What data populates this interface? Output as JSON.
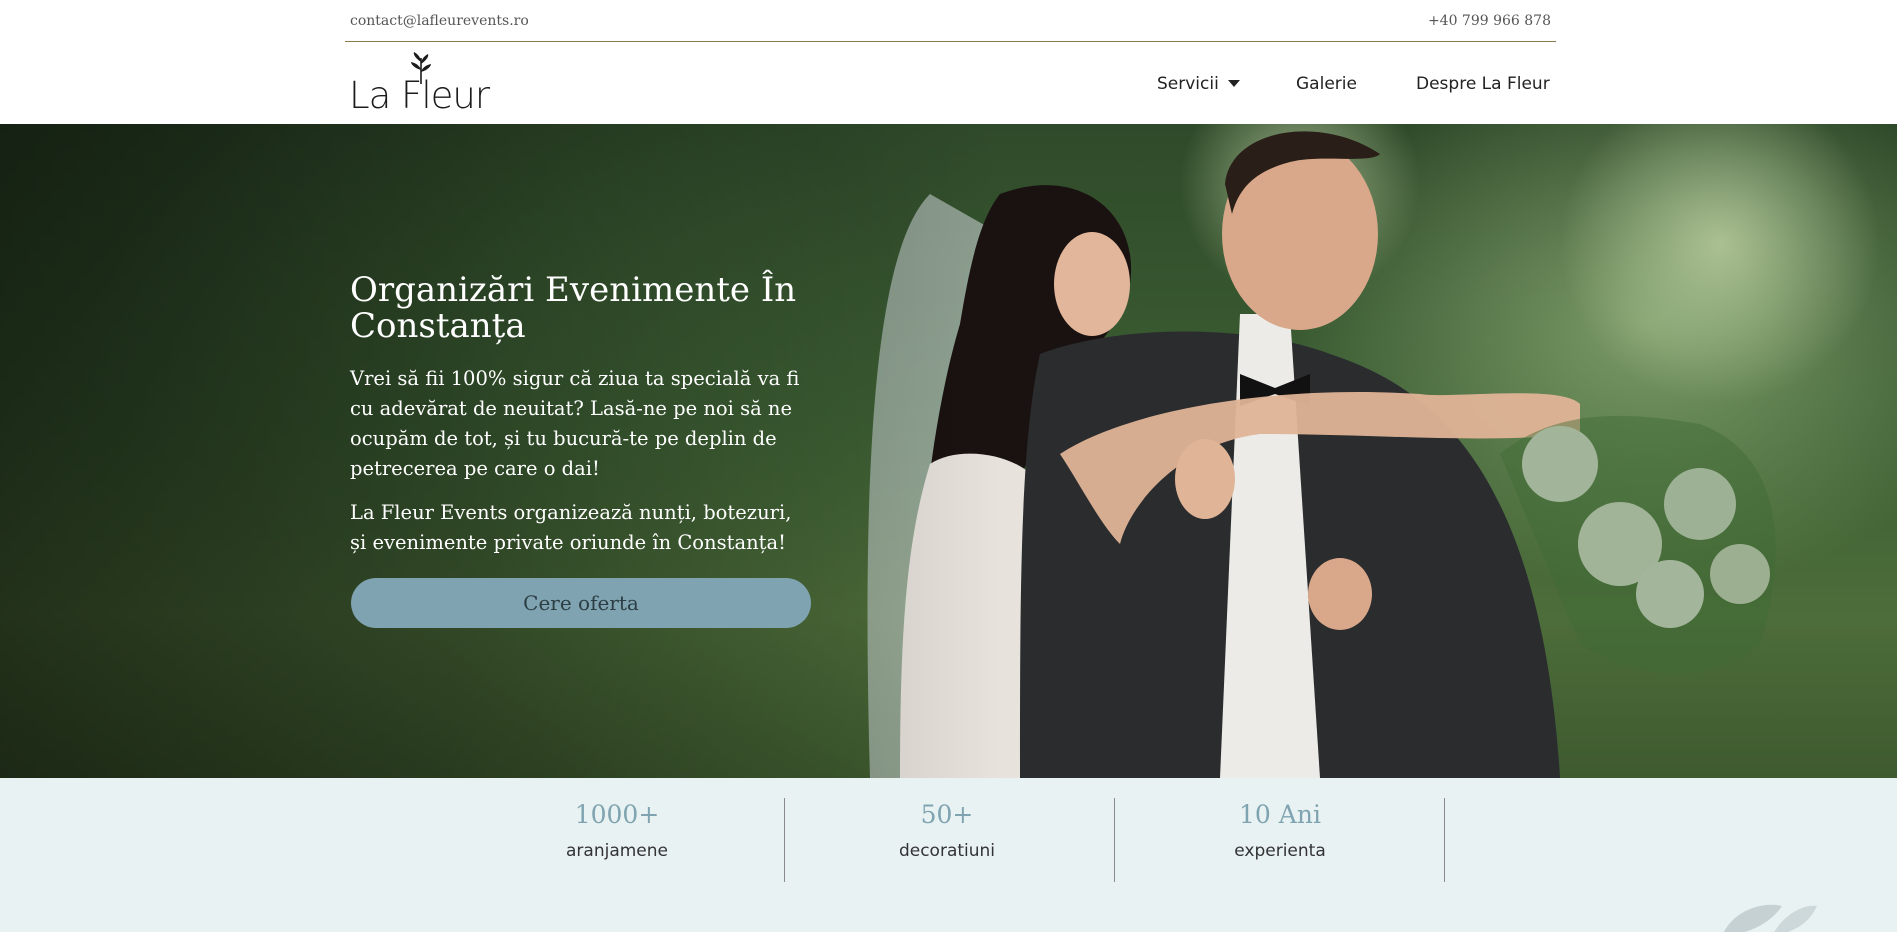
{
  "topbar": {
    "email": "contact@lafleurevents.ro",
    "phone": "+40 799 966 878"
  },
  "header": {
    "logo_text": "La Fleur",
    "nav": [
      {
        "label": "Servicii",
        "has_dropdown": true
      },
      {
        "label": "Galerie"
      },
      {
        "label": "Despre La Fleur"
      }
    ]
  },
  "hero": {
    "title": "Organizări Evenimente În Constanța",
    "paragraph1": "Vrei să fii 100% sigur că ziua ta specială va fi cu adevărat de neuitat? Lasă-ne pe noi să ne ocupăm de tot, și tu bucură-te pe deplin de petrecerea pe care o dai!",
    "paragraph2": "La Fleur Events organizează nunți, botezuri, și evenimente private oriunde în Constanța!",
    "cta_label": "Cere oferta"
  },
  "stats": [
    {
      "value": "1000+",
      "label": "aranjamene"
    },
    {
      "value": "50+",
      "label": "decoratiuni"
    },
    {
      "value": "10 Ani",
      "label": "experienta"
    }
  ],
  "colors": {
    "accent": "#7fa3b0",
    "stats_bg": "#e8f2f3",
    "topbar_rule": "#8a7a4e"
  }
}
